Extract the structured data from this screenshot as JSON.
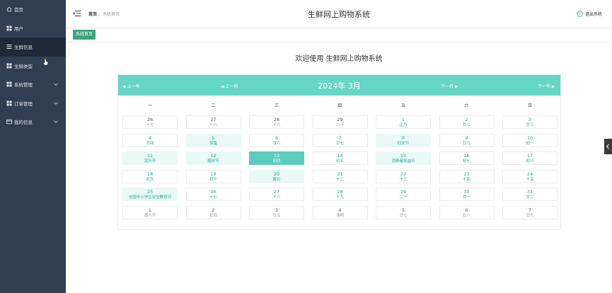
{
  "sidebar": {
    "items": [
      {
        "label": "首页",
        "icon": "home-icon",
        "expandable": false,
        "active": false
      },
      {
        "label": "用户",
        "icon": "grid-icon",
        "expandable": false,
        "active": false
      },
      {
        "label": "生鲜信息",
        "icon": "list-icon",
        "expandable": false,
        "active": true
      },
      {
        "label": "生鲜类型",
        "icon": "grid-icon",
        "expandable": false,
        "active": false
      },
      {
        "label": "系统管理",
        "icon": "grid-icon",
        "expandable": true,
        "active": false
      },
      {
        "label": "订单管理",
        "icon": "grid-icon",
        "expandable": true,
        "active": false
      },
      {
        "label": "我的信息",
        "icon": "card-icon",
        "expandable": true,
        "active": false
      }
    ]
  },
  "header": {
    "breadcrumb_home": "首页",
    "breadcrumb_sep": "/",
    "breadcrumb_current": "系统首页",
    "title": "生鲜网上购物系统",
    "logout": "退出系统"
  },
  "tabs": [
    {
      "label": "系统首页"
    }
  ],
  "welcome": "欢迎使用 生鲜网上购物系统",
  "calendar": {
    "title": "2024年 3月",
    "prev_year": "◀ 上一年",
    "prev_month": "◀ 上一月",
    "next_month": "下一月 ▶",
    "next_year": "下一年 ▶",
    "weekdays": [
      "一",
      "二",
      "三",
      "四",
      "五",
      "六",
      "日"
    ],
    "weeks": [
      [
        {
          "n": "26",
          "l": "十七",
          "c": false
        },
        {
          "n": "27",
          "l": "十八",
          "c": false
        },
        {
          "n": "28",
          "l": "十九",
          "c": false
        },
        {
          "n": "29",
          "l": "二十",
          "c": false
        },
        {
          "n": "1",
          "l": "正月",
          "c": true
        },
        {
          "n": "2",
          "l": "廿二",
          "c": true
        },
        {
          "n": "3",
          "l": "廿三",
          "c": true
        }
      ],
      [
        {
          "n": "4",
          "l": "廿四",
          "c": true
        },
        {
          "n": "5",
          "l": "惊蛰",
          "c": true,
          "h": true,
          "f": true
        },
        {
          "n": "6",
          "l": "廿六",
          "c": true
        },
        {
          "n": "7",
          "l": "廿七",
          "c": true
        },
        {
          "n": "8",
          "l": "妇女节",
          "c": true,
          "h": true,
          "f": true
        },
        {
          "n": "9",
          "l": "廿九",
          "c": true
        },
        {
          "n": "10",
          "l": "初一",
          "c": true
        }
      ],
      [
        {
          "n": "11",
          "l": "龙头节",
          "c": true,
          "h": true,
          "f": true
        },
        {
          "n": "12",
          "l": "植树节",
          "c": true,
          "h": true,
          "f": true
        },
        {
          "n": "13",
          "l": "初四",
          "c": true,
          "s": true
        },
        {
          "n": "14",
          "l": "初五",
          "c": true
        },
        {
          "n": "15",
          "l": "消费者权益日",
          "c": true,
          "h": true,
          "f": true
        },
        {
          "n": "16",
          "l": "初七",
          "c": true
        },
        {
          "n": "17",
          "l": "初八",
          "c": true
        }
      ],
      [
        {
          "n": "18",
          "l": "初九",
          "c": true
        },
        {
          "n": "19",
          "l": "初十",
          "c": true
        },
        {
          "n": "20",
          "l": "春分",
          "c": true,
          "h": true,
          "f": true
        },
        {
          "n": "21",
          "l": "十二",
          "c": true
        },
        {
          "n": "22",
          "l": "十三",
          "c": true
        },
        {
          "n": "23",
          "l": "十四",
          "c": true
        },
        {
          "n": "24",
          "l": "十五",
          "c": true
        }
      ],
      [
        {
          "n": "25",
          "l": "全国中小学生安全教育日",
          "c": true,
          "h": true,
          "f": true
        },
        {
          "n": "26",
          "l": "十七",
          "c": true
        },
        {
          "n": "27",
          "l": "十八",
          "c": true
        },
        {
          "n": "28",
          "l": "十九",
          "c": true
        },
        {
          "n": "29",
          "l": "二十",
          "c": true
        },
        {
          "n": "30",
          "l": "廿一",
          "c": true
        },
        {
          "n": "31",
          "l": "廿二",
          "c": true
        }
      ],
      [
        {
          "n": "1",
          "l": "愚人节",
          "c": false
        },
        {
          "n": "2",
          "l": "廿四",
          "c": false
        },
        {
          "n": "3",
          "l": "廿五",
          "c": false
        },
        {
          "n": "4",
          "l": "清明",
          "c": false
        },
        {
          "n": "5",
          "l": "廿七",
          "c": false
        },
        {
          "n": "6",
          "l": "廿八",
          "c": false
        },
        {
          "n": "7",
          "l": "廿九",
          "c": false
        }
      ]
    ]
  },
  "colors": {
    "sidebar_bg": "#2f3e52",
    "sidebar_active": "#1f2a38",
    "accent_green": "#3aa77e",
    "calendar_header": "#66d6c6",
    "selected_day": "#5ccdbd",
    "highlight_day": "#e9f9f5"
  }
}
